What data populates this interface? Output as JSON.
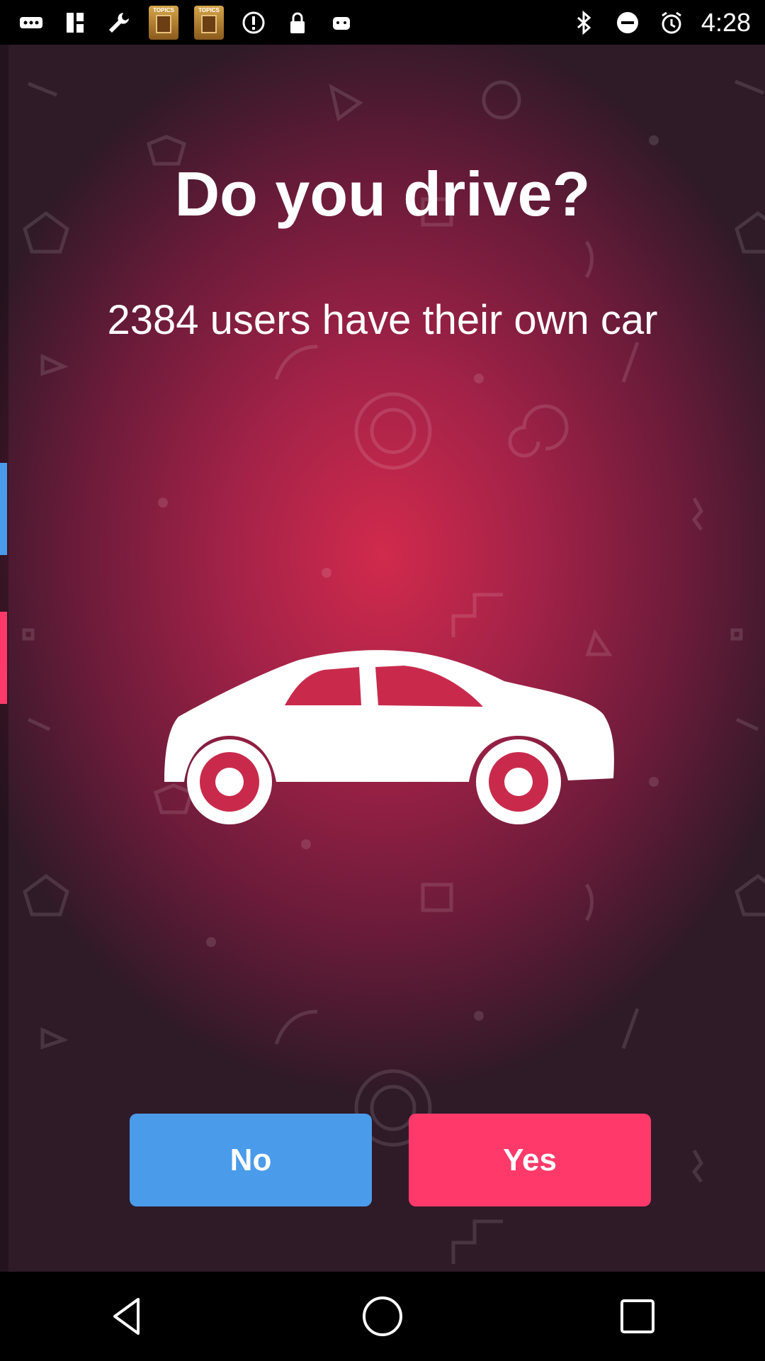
{
  "status_bar": {
    "time": "4:28",
    "app_thumb_label": "TOPICS",
    "left_icons": [
      "more-icon",
      "grid-icon",
      "wrench-icon",
      "topics-app-icon",
      "topics-app-icon",
      "alert-icon",
      "lock-icon",
      "android-icon"
    ],
    "right_icons": [
      "bluetooth-icon",
      "do-not-disturb-icon",
      "alarm-icon"
    ]
  },
  "main": {
    "title": "Do you drive?",
    "subtitle": "2384 users have their own car",
    "illustration": "car-icon",
    "buttons": {
      "no_label": "No",
      "yes_label": "Yes"
    }
  },
  "colors": {
    "no_button": "#4a9bea",
    "yes_button": "#ff3a6a",
    "background_center": "#d12a4c",
    "background_edge": "#2f1a28"
  },
  "nav_bar": {
    "icons": [
      "back-icon",
      "home-icon",
      "recents-icon"
    ]
  }
}
